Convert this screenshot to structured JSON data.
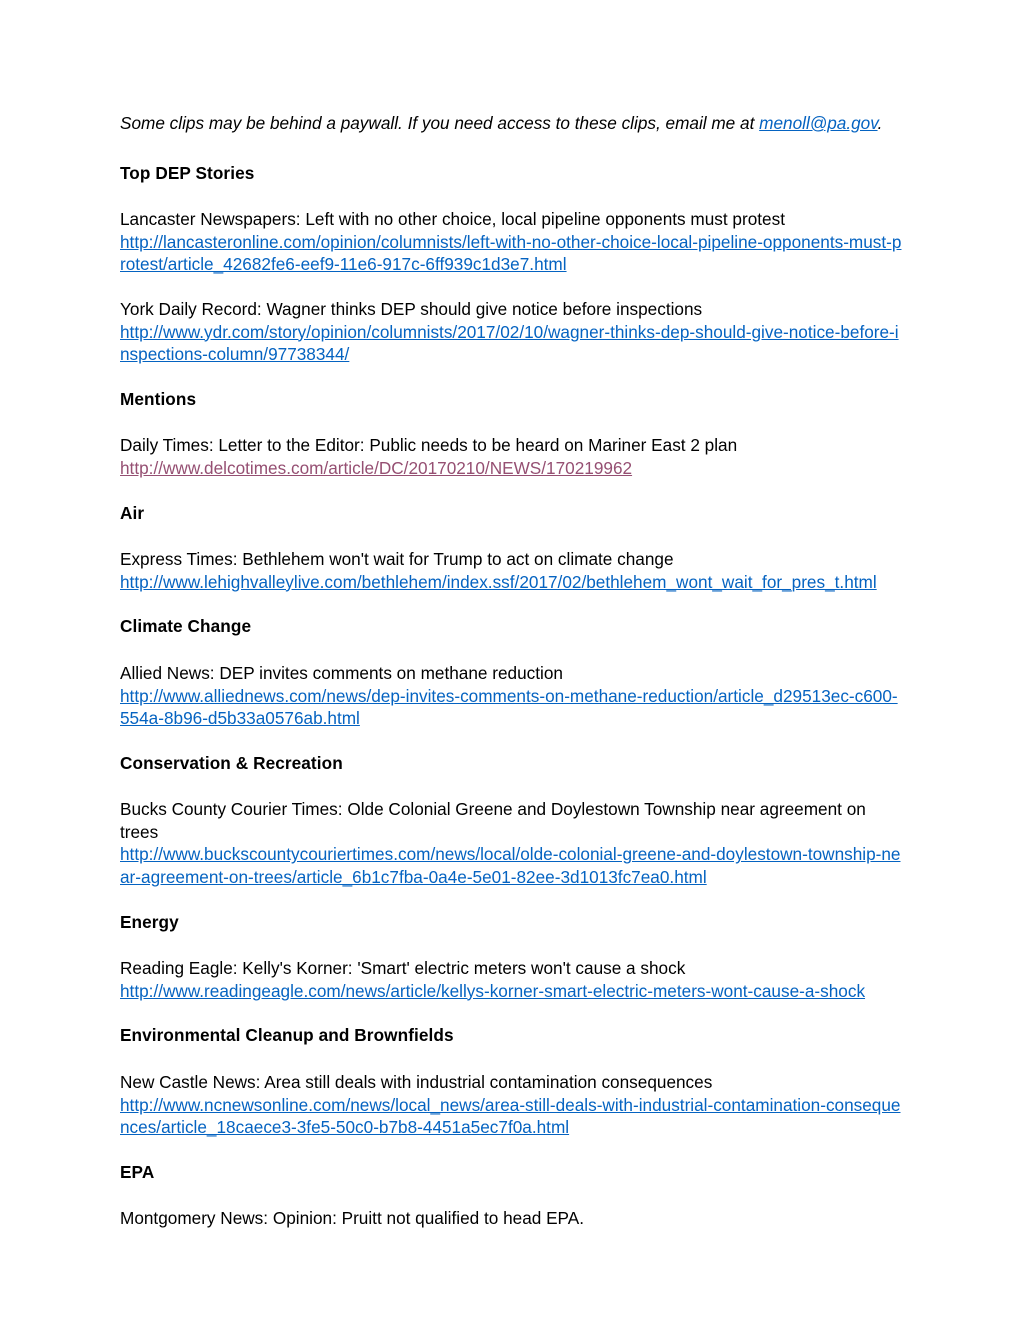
{
  "document": {
    "intro": {
      "text_before": "Some clips may be behind a paywall.  If you need access to these clips, email me at ",
      "email": "menoll@pa.gov",
      "text_after": "."
    },
    "sections": [
      {
        "heading": "Top DEP Stories",
        "stories": [
          {
            "headline": "Lancaster Newspapers: Left with no other choice, local pipeline opponents must protest",
            "url": "http://lancasteronline.com/opinion/columnists/left-with-no-other-choice-local-pipeline-opponents-must-protest/article_42682fe6-eef9-11e6-917c-6ff939c1d3e7.html",
            "url_color": "blue"
          },
          {
            "headline": "York Daily Record: Wagner thinks DEP should give notice before inspections",
            "url": "http://www.ydr.com/story/opinion/columnists/2017/02/10/wagner-thinks-dep-should-give-notice-before-inspections-column/97738344/",
            "url_color": "blue"
          }
        ]
      },
      {
        "heading": "Mentions",
        "stories": [
          {
            "headline": "Daily Times: Letter to the Editor: Public needs to be heard on Mariner East 2 plan",
            "url": "http://www.delcotimes.com/article/DC/20170210/NEWS/170219962",
            "url_color": "purple"
          }
        ]
      },
      {
        "heading": "Air",
        "stories": [
          {
            "headline": "Express Times: Bethlehem won't wait for Trump to act on climate change",
            "url": "http://www.lehighvalleylive.com/bethlehem/index.ssf/2017/02/bethlehem_wont_wait_for_pres_t.html",
            "url_color": "blue"
          }
        ]
      },
      {
        "heading": "Climate Change",
        "stories": [
          {
            "headline": "Allied News: DEP invites comments on methane reduction",
            "url": "http://www.alliednews.com/news/dep-invites-comments-on-methane-reduction/article_d29513ec-c600-554a-8b96-d5b33a0576ab.html",
            "url_color": "blue"
          }
        ]
      },
      {
        "heading": "Conservation & Recreation",
        "stories": [
          {
            "headline": "Bucks County Courier Times: Olde Colonial Greene and Doylestown Township near agreement on trees",
            "url": "http://www.buckscountycouriertimes.com/news/local/olde-colonial-greene-and-doylestown-township-near-agreement-on-trees/article_6b1c7fba-0a4e-5e01-82ee-3d1013fc7ea0.html",
            "url_color": "blue"
          }
        ]
      },
      {
        "heading": "Energy",
        "stories": [
          {
            "headline": "Reading Eagle: Kelly's Korner: 'Smart' electric meters won't cause a shock",
            "url": "http://www.readingeagle.com/news/article/kellys-korner-smart-electric-meters-wont-cause-a-shock",
            "url_color": "blue"
          }
        ]
      },
      {
        "heading": "Environmental Cleanup and Brownfields",
        "stories": [
          {
            "headline": "New Castle News: Area still deals with industrial contamination consequences",
            "url": "http://www.ncnewsonline.com/news/local_news/area-still-deals-with-industrial-contamination-consequences/article_18caece3-3fe5-50c0-b7b8-4451a5ec7f0a.html",
            "url_color": "blue"
          }
        ]
      },
      {
        "heading": "EPA",
        "stories": [
          {
            "headline": "Montgomery News: Opinion: Pruitt not qualified to head EPA.",
            "url": "",
            "url_color": "blue"
          }
        ]
      }
    ]
  },
  "colors": {
    "hyperlink": "#0563c1",
    "visited_hyperlink": "#954f72",
    "text": "#000000",
    "page_background": "#ffffff"
  }
}
